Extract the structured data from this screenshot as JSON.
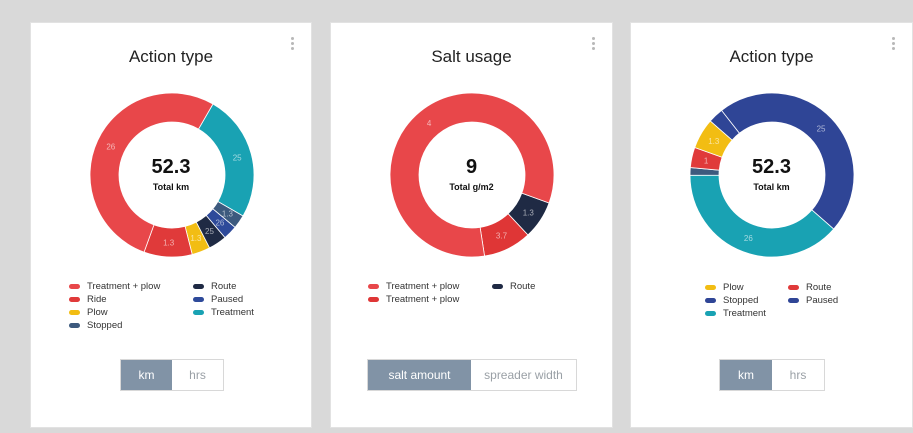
{
  "cards": [
    {
      "title": "Action type",
      "total_value": "52.3",
      "total_label": "Total km",
      "chart_data": {
        "type": "pie",
        "segments": [
          {
            "label": "Treatment",
            "value": 25,
            "display": "25",
            "color": "#19a2b3"
          },
          {
            "label": "Stopped",
            "value": 2.7,
            "display": "1.3",
            "color": "#3d5a7e"
          },
          {
            "label": "Paused",
            "value": 2.8,
            "display": "26",
            "color": "#2e4a9a"
          },
          {
            "label": "Route",
            "value": 3.6,
            "display": "25",
            "color": "#1f2a44"
          },
          {
            "label": "Plow",
            "value": 3.6,
            "display": "1.3",
            "color": "#f2bd13"
          },
          {
            "label": "Ride",
            "value": 9.5,
            "display": "1.3",
            "color": "#e03a3a"
          },
          {
            "label": "Treatment + plow",
            "value": 52.8,
            "display": "26",
            "color": "#e8474a"
          }
        ]
      },
      "legend": [
        {
          "label": "Treatment + plow",
          "color": "#e8474a"
        },
        {
          "label": "Ride",
          "color": "#e03a3a"
        },
        {
          "label": "Plow",
          "color": "#f2bd13"
        },
        {
          "label": "Stopped",
          "color": "#3d5a7e"
        },
        {
          "label": "Route",
          "color": "#1f2a44"
        },
        {
          "label": "Paused",
          "color": "#2e4a9a"
        },
        {
          "label": "Treatment",
          "color": "#19a2b3"
        }
      ],
      "toggle": {
        "option_a": "km",
        "option_b": "hrs"
      }
    },
    {
      "title": "Salt usage",
      "total_value": "9",
      "total_label": "Total g/m2",
      "chart_data": {
        "type": "pie",
        "segments": [
          {
            "label": "Route",
            "value": 7.5,
            "display": "1.3",
            "color": "#1f2a44"
          },
          {
            "label": "Treatment + plow",
            "value": 9.5,
            "display": "3.7",
            "color": "#df3636"
          },
          {
            "label": "Treatment + plow",
            "value": 83,
            "display": "4",
            "color": "#e8474a"
          }
        ]
      },
      "legend": [
        {
          "label": "Treatment + plow",
          "color": "#e8474a"
        },
        {
          "label": "Treatment + plow",
          "color": "#df3636"
        },
        {
          "label": "Route",
          "color": "#1f2a44"
        }
      ],
      "toggle": {
        "option_a": "salt amount",
        "option_b": "spreader width"
      }
    },
    {
      "title": "Action type",
      "total_value": "52.3",
      "total_label": "Total km",
      "chart_data": {
        "type": "pie",
        "segments": [
          {
            "label": "Stopped",
            "value": 47,
            "display": "25",
            "color": "#2f4596"
          },
          {
            "label": "Treatment",
            "value": 38.5,
            "display": "26",
            "color": "#19a2b3"
          },
          {
            "label": "Paused",
            "value": 1.5,
            "display": "",
            "color": "#3d5a7e"
          },
          {
            "label": "Route",
            "value": 4,
            "display": "1",
            "color": "#e03a3a"
          },
          {
            "label": "Plow",
            "value": 6,
            "display": "1.3",
            "color": "#f2bd13"
          },
          {
            "label": "Stopped",
            "value": 3,
            "display": "",
            "color": "#2f4596"
          }
        ]
      },
      "legend": [
        {
          "label": "Plow",
          "color": "#f2bd13"
        },
        {
          "label": "Stopped",
          "color": "#2f4596"
        },
        {
          "label": "Treatment",
          "color": "#19a2b3"
        },
        {
          "label": "Route",
          "color": "#e03a3a"
        },
        {
          "label": "Paused",
          "color": "#2f4596"
        }
      ],
      "toggle": {
        "option_a": "km",
        "option_b": "hrs"
      }
    }
  ]
}
